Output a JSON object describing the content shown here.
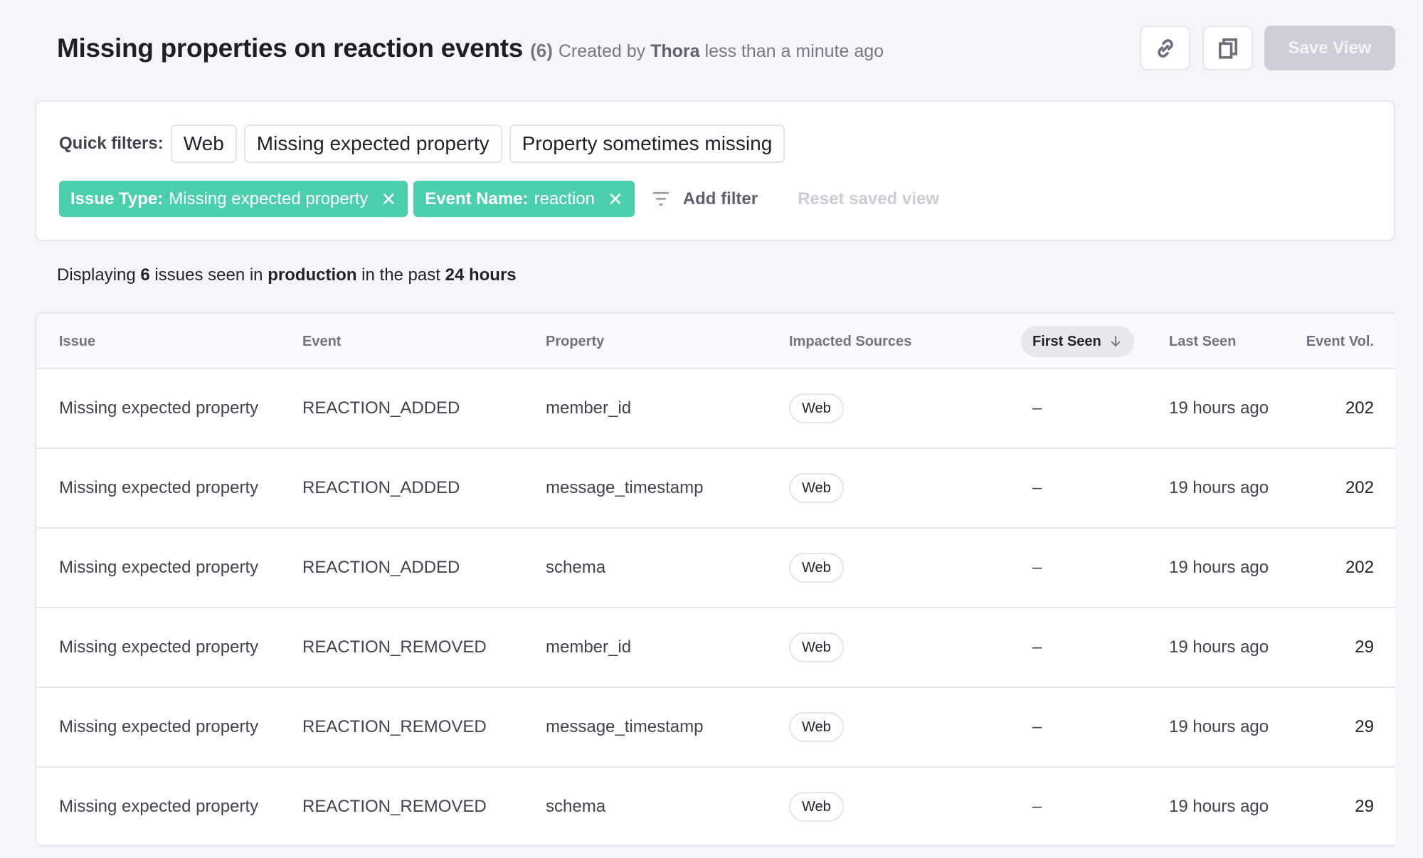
{
  "header": {
    "title": "Missing properties on reaction events",
    "count": "(6)",
    "created_prefix": "Created by",
    "author": "Thora",
    "created_time": "less than a minute ago",
    "link_button_icon": "link-icon",
    "copy_button_icon": "copy-icon",
    "save_label": "Save View"
  },
  "filters": {
    "quick_label": "Quick filters:",
    "quick": [
      "Web",
      "Missing expected property",
      "Property sometimes missing"
    ],
    "active": [
      {
        "key": "Issue Type:",
        "value": "Missing expected property"
      },
      {
        "key": "Event Name:",
        "value": "reaction"
      }
    ],
    "remove_glyph": "✕",
    "add_filter_label": "Add filter",
    "reset_label": "Reset saved view",
    "accent_color": "#4bcfae"
  },
  "summary": {
    "prefix": "Displaying",
    "count": "6",
    "mid1": "issues seen in",
    "environment": "production",
    "mid2": "in the past",
    "window": "24 hours"
  },
  "table": {
    "columns": [
      "Issue",
      "Event",
      "Property",
      "Impacted Sources",
      "First Seen",
      "Last Seen",
      "Event Vol."
    ],
    "sort_column": "First Seen",
    "sort_direction": "descending",
    "rows": [
      {
        "issue": "Missing expected property",
        "event": "REACTION_ADDED",
        "property": "member_id",
        "source": "Web",
        "first_seen": "–",
        "last_seen": "19 hours ago",
        "volume": "202"
      },
      {
        "issue": "Missing expected property",
        "event": "REACTION_ADDED",
        "property": "message_timestamp",
        "source": "Web",
        "first_seen": "–",
        "last_seen": "19 hours ago",
        "volume": "202"
      },
      {
        "issue": "Missing expected property",
        "event": "REACTION_ADDED",
        "property": "schema",
        "source": "Web",
        "first_seen": "–",
        "last_seen": "19 hours ago",
        "volume": "202"
      },
      {
        "issue": "Missing expected property",
        "event": "REACTION_REMOVED",
        "property": "member_id",
        "source": "Web",
        "first_seen": "–",
        "last_seen": "19 hours ago",
        "volume": "29"
      },
      {
        "issue": "Missing expected property",
        "event": "REACTION_REMOVED",
        "property": "message_timestamp",
        "source": "Web",
        "first_seen": "–",
        "last_seen": "19 hours ago",
        "volume": "29"
      },
      {
        "issue": "Missing expected property",
        "event": "REACTION_REMOVED",
        "property": "schema",
        "source": "Web",
        "first_seen": "–",
        "last_seen": "19 hours ago",
        "volume": "29"
      }
    ]
  }
}
